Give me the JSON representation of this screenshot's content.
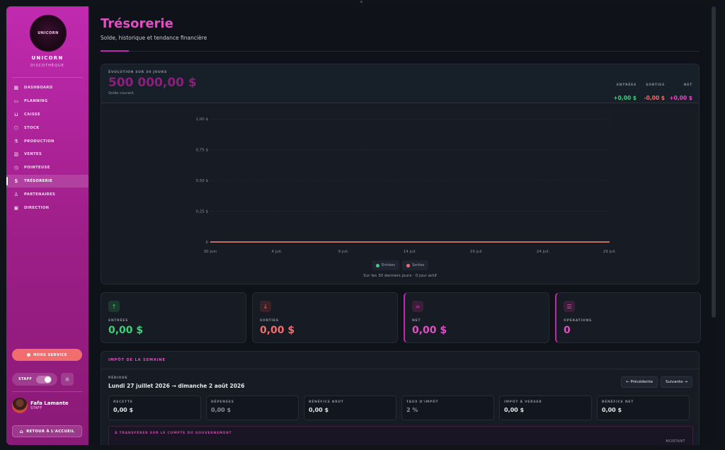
{
  "sidebar": {
    "logo_text": "UNICORN",
    "brand": "UNICORN",
    "brand_sub": "DISCOTHÈQUE",
    "items": [
      {
        "label": "DASHBOARD",
        "icon": "grid-icon"
      },
      {
        "label": "PLANNING",
        "icon": "calendar-icon"
      },
      {
        "label": "CAISSE",
        "icon": "cart-icon"
      },
      {
        "label": "STOCK",
        "icon": "box-icon"
      },
      {
        "label": "PRODUCTION",
        "icon": "flask-icon"
      },
      {
        "label": "VENTES",
        "icon": "chart-icon"
      },
      {
        "label": "POINTEUSE",
        "icon": "clock-icon"
      },
      {
        "label": "TRÉSORERIE",
        "icon": "dollar-icon",
        "active": true
      },
      {
        "label": "PARTENAIRES",
        "icon": "users-icon"
      },
      {
        "label": "DIRECTION",
        "icon": "briefcase-icon"
      }
    ],
    "service_button": "HORS SERVICE",
    "staff_label": "STAFF",
    "user_name": "Fafa Lamante",
    "user_role": "STAFF",
    "back_button": "RETOUR À L'ACCUEIL"
  },
  "header": {
    "title": "Trésorerie",
    "subtitle": "Solde, historique et tendance financière"
  },
  "balance": {
    "kicker": "ÉVOLUTION SUR 30 JOURS",
    "amount": "500 000,00 $",
    "note": "Solde courant",
    "stats": [
      {
        "label": "ENTRÉES",
        "value": "+0,00 $",
        "color": "#3ed17a"
      },
      {
        "label": "SORTIES",
        "value": "-0,00 $",
        "color": "#f26d6d"
      },
      {
        "label": "NET",
        "value": "+0,00 $",
        "color": "#e04fc4"
      }
    ]
  },
  "chart_data": {
    "type": "line",
    "categories": [
      "30 juin",
      "4 juil.",
      "9 juil.",
      "14 juil.",
      "19 juil.",
      "24 juil.",
      "29 juil."
    ],
    "y_ticks": [
      "1,00 $",
      "0,75 $",
      "0,50 $",
      "0,25 $",
      "0"
    ],
    "ylim": [
      0,
      1
    ],
    "grid": true,
    "legend_position": "bottom",
    "series": [
      {
        "name": "Entrées",
        "color": "#3ed17a",
        "values": [
          0,
          0,
          0,
          0,
          0,
          0,
          0
        ]
      },
      {
        "name": "Sorties",
        "color": "#f26d6d",
        "values": [
          0,
          0,
          0,
          0,
          0,
          0,
          0
        ]
      }
    ],
    "footnote": "Sur les 30 derniers jours · 0 jour actif"
  },
  "kpis": [
    {
      "label": "ENTRÉES",
      "value": "0,00 $",
      "icon": "arrow-up-icon",
      "symbol": "↑",
      "color": "#3ed17a"
    },
    {
      "label": "SORTIES",
      "value": "0,00 $",
      "icon": "arrow-down-icon",
      "symbol": "↓",
      "color": "#f26d6d"
    },
    {
      "label": "NET",
      "value": "0,00 $",
      "icon": "equals-icon",
      "symbol": "=",
      "color": "#e04fc4"
    },
    {
      "label": "OPÉRATIONS",
      "value": "0",
      "icon": "list-icon",
      "symbol": "☰",
      "color": "#e04fc4"
    }
  ],
  "tax": {
    "title": "IMPÔT DE LA SEMAINE",
    "period_label": "PÉRIODE",
    "period": "Lundi 27 juillet 2026 → dimanche 2 août 2026",
    "prev_button": "← Précédente",
    "next_button": "Suivante →",
    "metrics": [
      {
        "label": "RECETTE",
        "value": "0,00 $"
      },
      {
        "label": "DÉPENSES",
        "value": "0,00 $"
      },
      {
        "label": "BÉNÉFICE BRUT",
        "value": "0,00 $"
      },
      {
        "label": "TAUX D'IMPÔT",
        "value": "2 %"
      },
      {
        "label": "IMPÔT À VERSER",
        "value": "0,00 $"
      },
      {
        "label": "BÉNÉFICE NET",
        "value": "0,00 $"
      }
    ],
    "transfer_label": "À TRANSFÉRER SUR LE COMPTE DU GOUVERNEMENT",
    "amount_label": "MONTANT"
  },
  "colors": {
    "accent": "#c12ab0",
    "pink": "#e04fc4",
    "green": "#3ed17a",
    "red": "#f26d6d"
  }
}
